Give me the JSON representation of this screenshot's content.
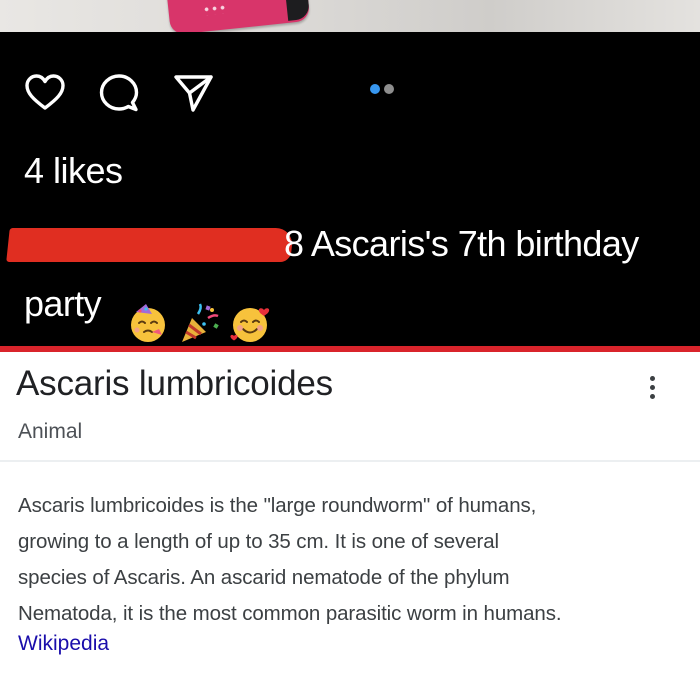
{
  "post": {
    "icons": {
      "like": "heart-icon",
      "comment": "comment-icon",
      "share": "paper-plane-icon"
    },
    "carousel": {
      "total": 2,
      "active_index": 0,
      "active_color": "#3797f0",
      "idle_color": "#8e8e8e"
    },
    "likes_text": "4 likes",
    "caption": {
      "visible_text": "8 Ascaris's 7th birthday",
      "continuation": "party",
      "emojis": [
        "partying-face-emoji",
        "party-popper-emoji",
        "smiling-face-with-hearts-emoji"
      ]
    },
    "background_color": "#000000"
  },
  "knowledge_panel": {
    "title": "Ascaris lumbricoides",
    "subtitle": "Animal",
    "description_lines": [
      "Ascaris lumbricoides is the \"large roundworm\" of humans,",
      "growing to a length of up to 35 cm. It is one of several",
      "species of Ascaris. An ascarid nematode of the phylum",
      "Nematoda, it is the most common parasitic worm in humans."
    ],
    "source_label": "Wikipedia",
    "more_icon": "more-vert-icon",
    "link_color": "#1a0dab"
  },
  "colors": {
    "redaction": "#e02e21",
    "divider": "#d9242b"
  }
}
